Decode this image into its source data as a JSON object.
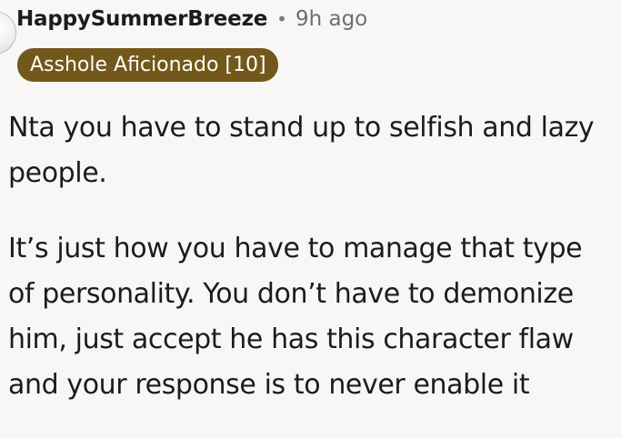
{
  "comment": {
    "author": "HappySummerBreeze",
    "separator": "•",
    "timestamp": "9h ago",
    "flair": "Asshole Aficionado [10]",
    "paragraphs": [
      "Nta you have to stand up to selfish and lazy people.",
      "It’s just how you have to manage that type of personality. You don’t have to demonize him, just accept he has this character flaw and your response is to never enable it"
    ]
  },
  "colors": {
    "background": "#f8f7f5",
    "flair_background": "#72581a",
    "flair_text": "#ffffff",
    "timestamp": "#6f6f6f"
  }
}
